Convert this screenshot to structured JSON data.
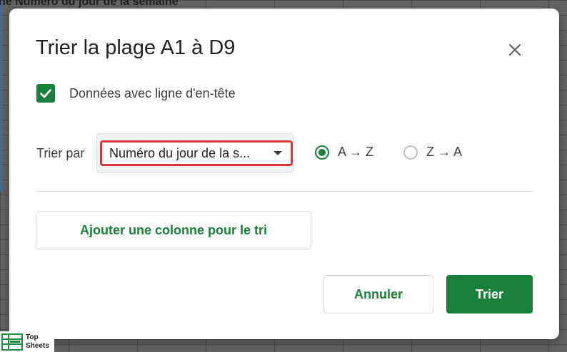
{
  "background": {
    "header_text": "ne  Numéro du jour de la semaine"
  },
  "dialog": {
    "title": "Trier la plage A1 à D9",
    "close_icon": "close-icon",
    "header_checkbox": {
      "checked": true,
      "label": "Données avec ligne d'en-tête"
    },
    "sort_rule": {
      "label": "Trier par",
      "selected_column": "Numéro du jour de la s...",
      "options": [
        {
          "label": "A → Z",
          "selected": true
        },
        {
          "label": "Z → A",
          "selected": false
        }
      ]
    },
    "add_column_label": "Ajouter une colonne pour le tri",
    "cancel_label": "Annuler",
    "sort_label": "Trier"
  },
  "logo": {
    "line1": "Top",
    "line2": "Sheets"
  },
  "colors": {
    "accent": "#188038",
    "highlight": "#d9383c"
  }
}
